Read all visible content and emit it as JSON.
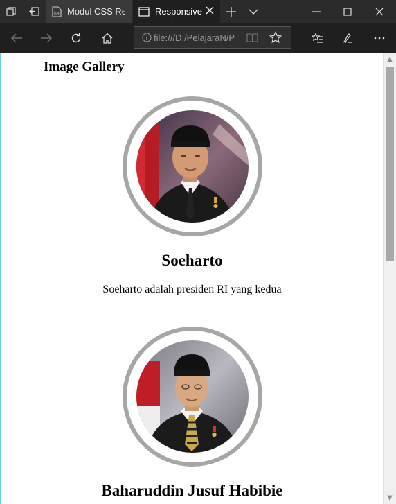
{
  "browser": {
    "tabs": [
      {
        "label": "Modul CSS Res",
        "active": false,
        "icon": "pdf-icon"
      },
      {
        "label": "Responsive",
        "active": true,
        "icon": "page-icon"
      }
    ],
    "address": "file:///D:/PelajaraN/P"
  },
  "page": {
    "heading": "Image Gallery",
    "cards": [
      {
        "name": "Soeharto",
        "description": "Soeharto adalah presiden RI yang kedua"
      },
      {
        "name": "Baharuddin Jusuf Habibie",
        "description": ""
      }
    ]
  },
  "colors": {
    "chrome_dark": "#1f1f1f",
    "tab_inactive": "#3a3a3a",
    "ring": "#a6a6a6",
    "scroll_thumb": "#a8a8a8"
  }
}
